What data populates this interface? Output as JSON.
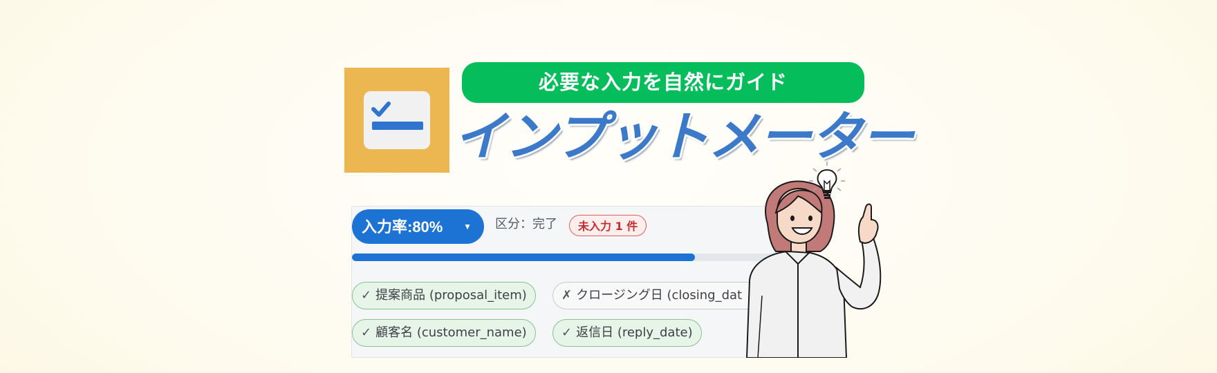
{
  "banner": {
    "tagline": "必要な入力を自然にガイド",
    "app_title": "インプットメーター",
    "logo_icon": "checklist-icon"
  },
  "meter": {
    "rate_label": "入力率:80%",
    "rate_value": 80,
    "caret": "▼",
    "status": "区分：完了",
    "missing_badge": "未入力 1 件",
    "fields": [
      {
        "mark": "✓",
        "label": "提案商品 (proposal_item)",
        "filled": true
      },
      {
        "mark": "✗",
        "label": "クロージング日 (closing_dat",
        "filled": false
      },
      {
        "mark": "✓",
        "label": "顧客名 (customer_name)",
        "filled": true
      },
      {
        "mark": "✓",
        "label": "返信日 (reply_date)",
        "filled": true
      }
    ]
  },
  "illustration": {
    "icon": "lightbulb-icon",
    "figure": "woman-pointing-up"
  },
  "colors": {
    "accent_blue": "#1c73d4",
    "tagline_green": "#06bd5c",
    "logo_orange": "#ecb650",
    "title_blue": "#3d79c9",
    "ok_bg": "#e7f4e8",
    "missing_red": "#e05d5d"
  }
}
